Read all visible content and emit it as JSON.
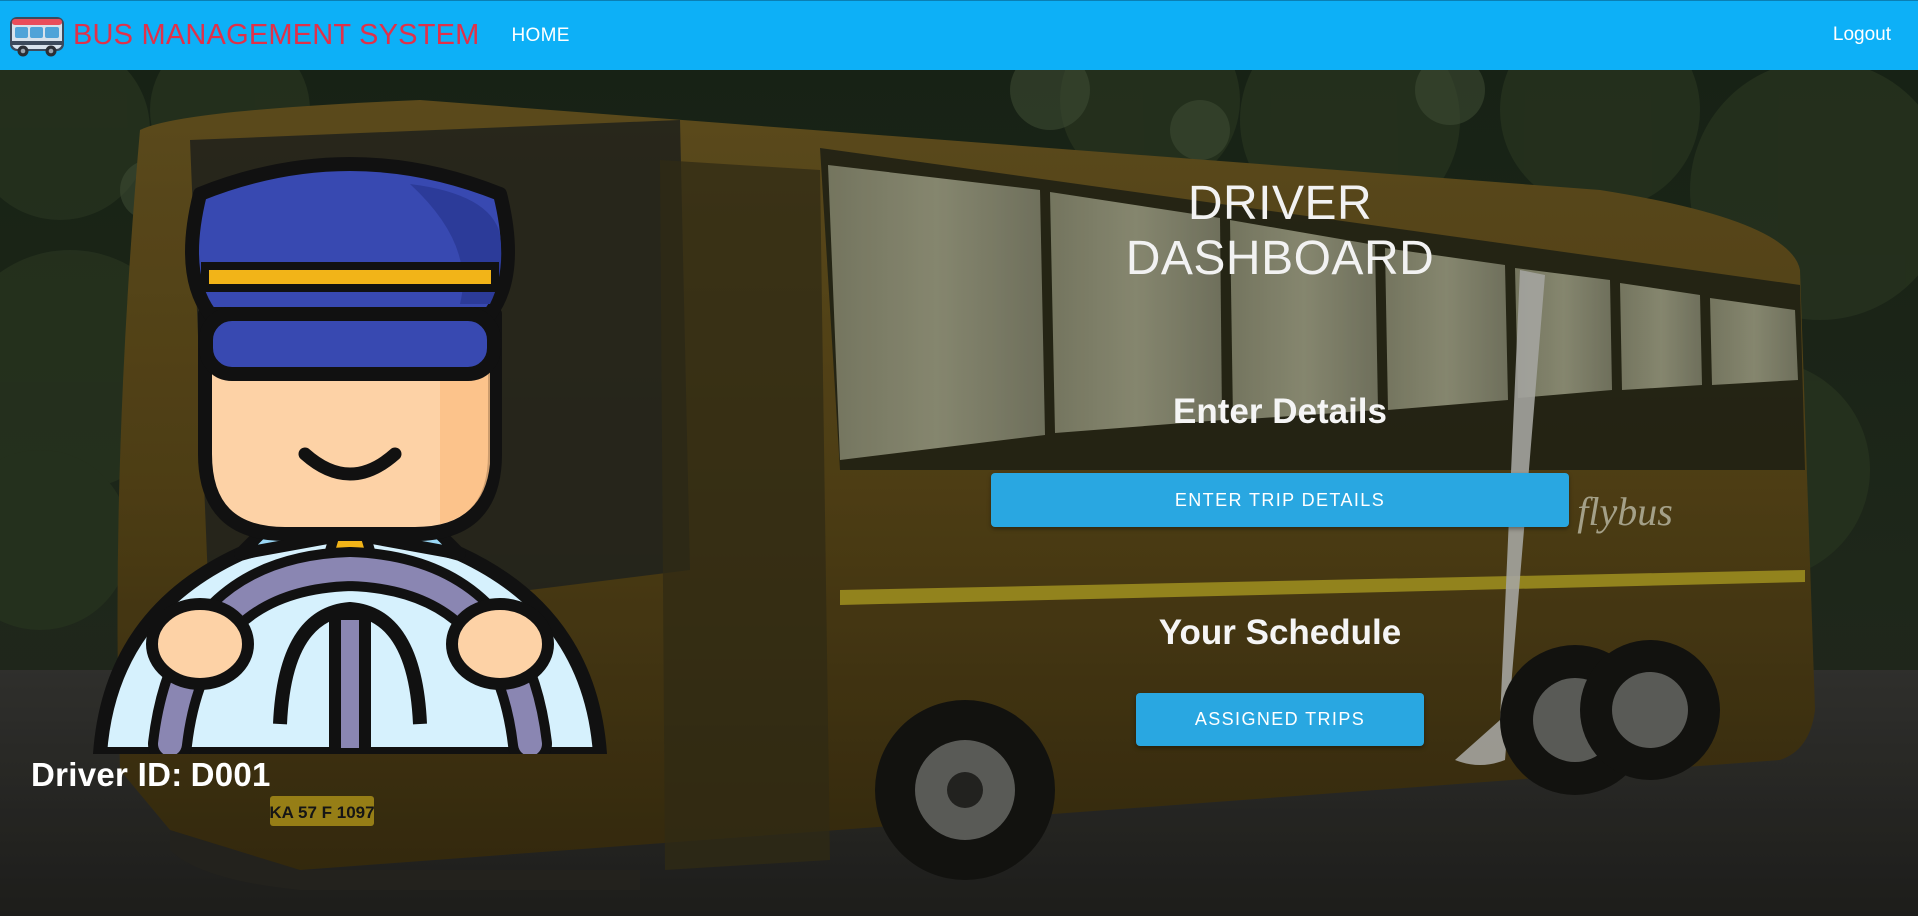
{
  "navbar": {
    "brand_icon": "bus-icon",
    "brand_text": "BUS MANAGEMENT SYSTEM",
    "home_label": "HOME",
    "logout_label": "Logout",
    "bg_color": "#0db0f7",
    "brand_color": "#e0314a"
  },
  "dashboard": {
    "title": "DRIVER DASHBOARD",
    "enter_details_heading": "Enter Details",
    "enter_trip_button": "ENTER TRIP DETAILS",
    "schedule_heading": "Your Schedule",
    "assigned_trips_button": "ASSIGNED TRIPS",
    "button_color": "#29a7e1"
  },
  "driver": {
    "avatar_icon": "driver-avatar-icon",
    "id_label": "Driver ID:",
    "id_value": "D001"
  },
  "background": {
    "description_icon": "bus-photo-background",
    "plate_text": "KA 57 F 1097",
    "bus_brand_text": "flybus"
  }
}
